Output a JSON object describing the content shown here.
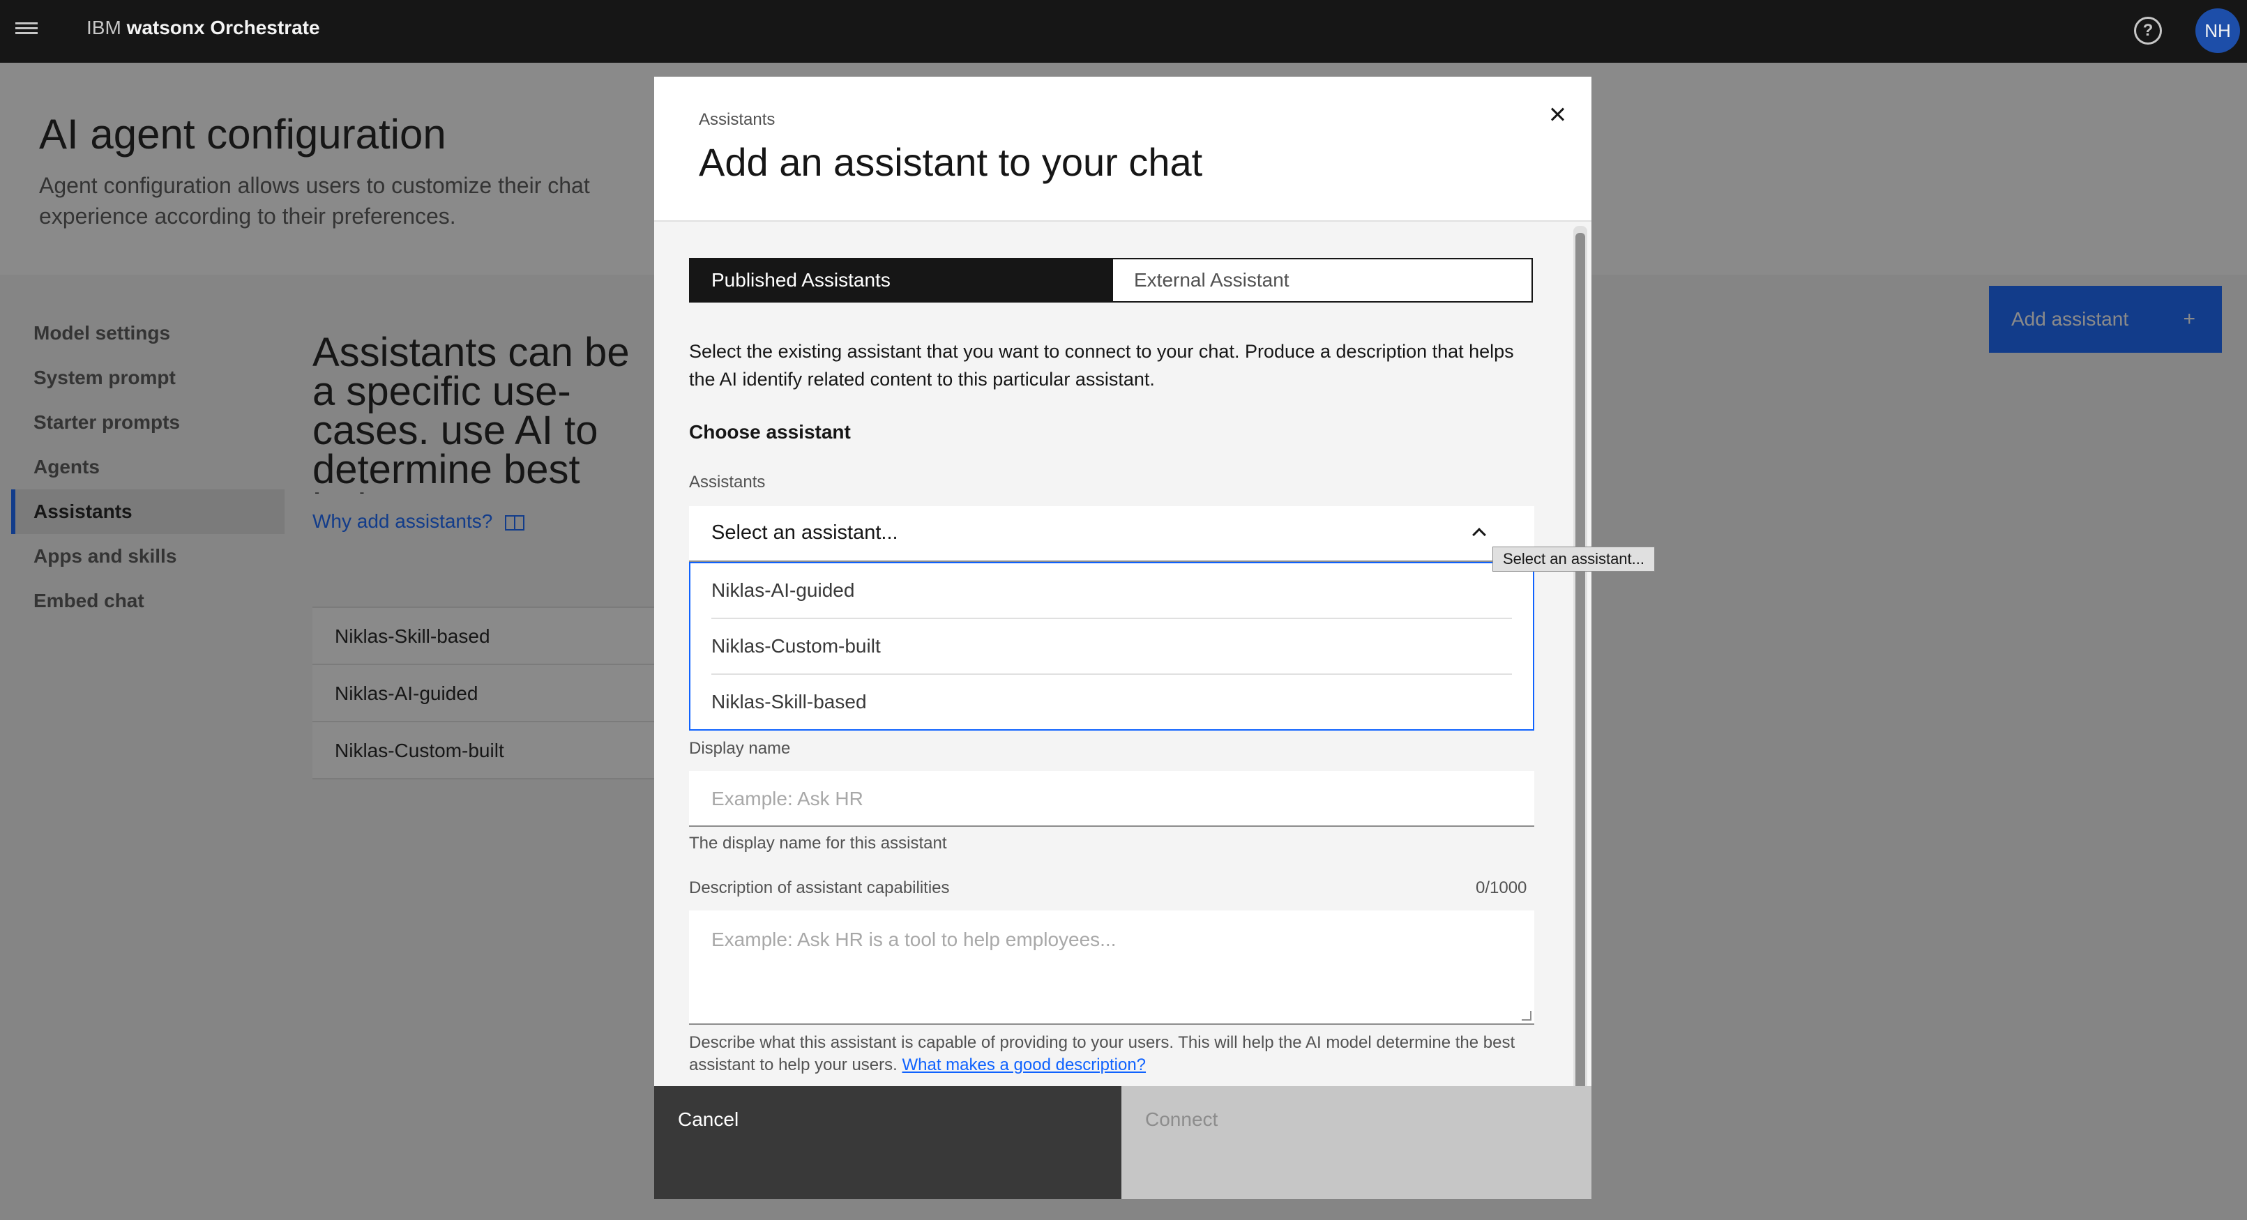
{
  "topbar": {
    "brand_prefix": "IBM ",
    "brand_name": "watsonx Orchestrate",
    "help_icon": "help-icon",
    "avatar_initials": "NH"
  },
  "page": {
    "title": "AI agent configuration",
    "subtitle": "Agent configuration allows users to customize their chat experience according to their preferences."
  },
  "sidenav": {
    "items": [
      {
        "label": "Model settings"
      },
      {
        "label": "System prompt"
      },
      {
        "label": "Starter prompts"
      },
      {
        "label": "Agents"
      },
      {
        "label": "Assistants",
        "active": true
      },
      {
        "label": "Apps and skills"
      },
      {
        "label": "Embed chat"
      }
    ]
  },
  "main": {
    "heading": "Assistants can be a specific use-cases. use AI to determine best help your users",
    "why_link": "Why add assistants?",
    "add_button": "Add assistant",
    "assistants": [
      "Niklas-Skill-based",
      "Niklas-AI-guided",
      "Niklas-Custom-built"
    ]
  },
  "modal": {
    "eyebrow": "Assistants",
    "title": "Add an assistant to your chat",
    "tabs": [
      "Published Assistants",
      "External Assistant"
    ],
    "intro": "Select the existing assistant that you want to connect to your chat. Produce a description that helps the AI identify related content to this particular assistant.",
    "choose_heading": "Choose assistant",
    "assistants_label": "Assistants",
    "dropdown_value": "Select an assistant...",
    "dropdown_options": [
      "Niklas-AI-guided",
      "Niklas-Custom-built",
      "Niklas-Skill-based"
    ],
    "tooltip": "Select an assistant...",
    "display_name_label": "Display name",
    "display_name_placeholder": "Example: Ask HR",
    "display_name_helper": "The display name for this assistant",
    "description_label": "Description of assistant capabilities",
    "description_counter": "0/1000",
    "description_placeholder": "Example: Ask HR is a tool to help employees...",
    "description_help": "Describe what this assistant is capable of providing to your users. This will help the AI model determine the best assistant to help your users.",
    "description_help_link": "What makes a good description?",
    "cancel_label": "Cancel",
    "connect_label": "Connect"
  },
  "colors": {
    "accent": "#0f62fe",
    "topbar": "#161616",
    "avatar": "#1d4ea9"
  }
}
